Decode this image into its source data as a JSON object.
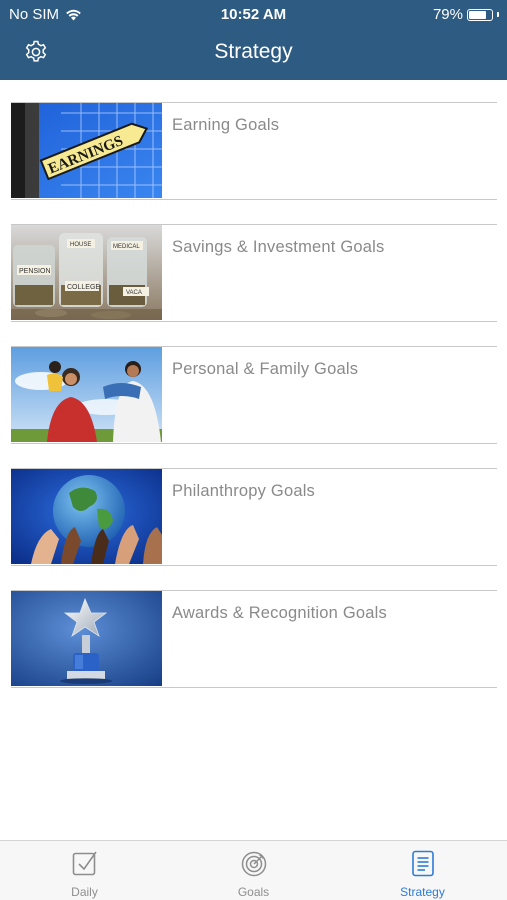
{
  "status_bar": {
    "carrier": "No SIM",
    "time": "10:52 AM",
    "battery_percent": "79%",
    "battery_level": 0.79
  },
  "header": {
    "title": "Strategy",
    "settings_icon": "gear-icon"
  },
  "goals": [
    {
      "label": "Earning Goals",
      "image": "earnings-sign",
      "image_text": "EARNINGS"
    },
    {
      "label": "Savings & Investment Goals",
      "image": "savings-jars",
      "image_text": [
        "PENSION",
        "COLLEGE",
        "HOUSE",
        "MEDICAL",
        "VACA"
      ]
    },
    {
      "label": "Personal & Family Goals",
      "image": "family-photo"
    },
    {
      "label": "Philanthropy Goals",
      "image": "hands-globe"
    },
    {
      "label": "Awards & Recognition Goals",
      "image": "star-trophy"
    }
  ],
  "tabs": [
    {
      "label": "Daily",
      "icon": "checkbox-icon",
      "active": false
    },
    {
      "label": "Goals",
      "icon": "target-icon",
      "active": false
    },
    {
      "label": "Strategy",
      "icon": "document-icon",
      "active": true
    }
  ],
  "colors": {
    "header": "#2d5b82",
    "accent": "#2d7bd6",
    "label": "#8a8a8a"
  }
}
